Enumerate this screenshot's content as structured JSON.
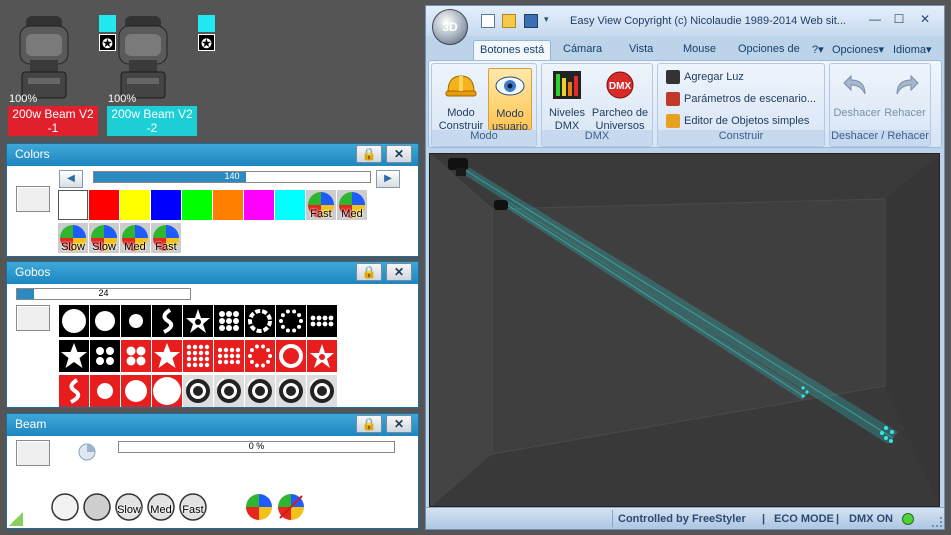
{
  "fixtures": [
    {
      "percent": "100%",
      "name_line1": "200w Beam V2",
      "name_line2": "-1",
      "label_color": "#e0202c",
      "swatch": "#22e8f2"
    },
    {
      "percent": "100%",
      "name_line1": "200w Beam V2",
      "name_line2": "-2",
      "label_color": "#1ccfd6",
      "swatch": "#22e8f2"
    }
  ],
  "colors_panel": {
    "title": "Colors",
    "slider_value": "140",
    "slider_fraction": 0.55,
    "swatches": [
      "#ffffff",
      "#ff0000",
      "#ffff00",
      "#0000ff",
      "#00ff00",
      "#ff7f00",
      "#ff00ff",
      "#00ffff"
    ],
    "wheel_buttons_row1": [
      "Fast",
      "Med"
    ],
    "wheel_buttons_row2": [
      "Slow",
      "Slow",
      "Med",
      "Fast"
    ]
  },
  "gobos_panel": {
    "title": "Gobos",
    "slider_value": "24",
    "slider_fraction": 0.1,
    "gobo_count_row1": 9,
    "gobo_count_row2": 9,
    "gobo_count_row3": 9
  },
  "beam_panel": {
    "title": "Beam",
    "slider_value": "0 %",
    "slider_fraction": 0,
    "buttons": [
      "Slow",
      "Med",
      "Fast"
    ]
  },
  "app": {
    "logo_text": "3D",
    "window_title": "Easy View   Copyright (c) Nicolaudie 1989-2014   Web sit...",
    "tabs": [
      "Botones está",
      "Cámara",
      "Vista",
      "Mouse",
      "Opciones de",
      "?",
      "Opciones",
      "Idioma"
    ],
    "groups": {
      "modo": {
        "label": "Modo",
        "construir_line1": "Modo",
        "construir_line2": "Construir",
        "usuario_line1": "Modo",
        "usuario_line2": "usuario"
      },
      "dmx": {
        "label": "DMX",
        "niveles_line1": "Niveles",
        "niveles_line2": "DMX",
        "parcheo_line1": "Parcheo de",
        "parcheo_line2": "Universos",
        "dmx_icon_text": "DMX"
      },
      "construir": {
        "label": "Construir",
        "item1": "Agregar Luz",
        "item2": "Parámetros de escenario...",
        "item3": "Editor de Objetos simples"
      },
      "historial": {
        "label": "Deshacer / Rehacer",
        "undo": "Deshacer",
        "redo": "Rehacer"
      }
    },
    "status": {
      "controlled": "Controlled by FreeStyler",
      "eco": "ECO MODE",
      "dmx": "DMX ON",
      "led_color": "#4cd43a"
    }
  }
}
